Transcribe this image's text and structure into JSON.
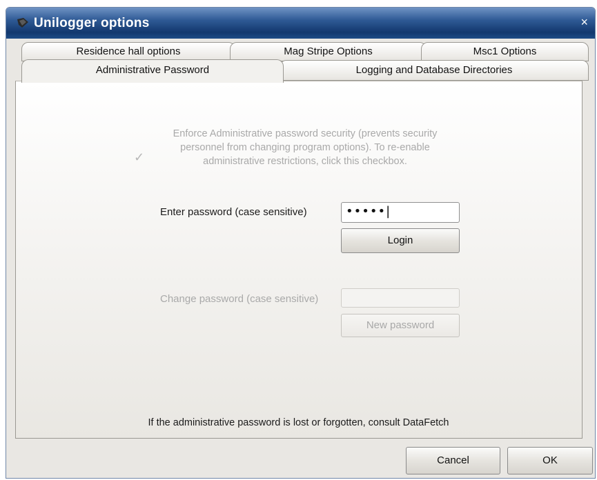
{
  "window": {
    "title": "Unilogger options",
    "close_glyph": "×",
    "icon": "app-icon"
  },
  "tabs": {
    "back_row": [
      "Residence hall options",
      "Mag Stripe Options",
      "Msc1 Options"
    ],
    "front_row": [
      "Administrative Password",
      "Logging and Database Directories"
    ],
    "active": "Administrative Password"
  },
  "admin": {
    "enforce_checkbox_checked": true,
    "enforce_text": "Enforce Administrative password security (prevents security personnel from changing program options). To re-enable administrative restrictions, click this checkbox.",
    "enter_label": "Enter password (case sensitive)",
    "enter_value": "•••••|",
    "login_label": "Login",
    "change_label": "Change password (case sensitive)",
    "change_value": "",
    "new_password_label": "New password",
    "footer": "If the administrative password is lost or forgotten, consult DataFetch"
  },
  "buttons": {
    "cancel": "Cancel",
    "ok": "OK"
  },
  "colors": {
    "titlebar": "#12386e",
    "disabled_text": "#a9a9a9"
  }
}
